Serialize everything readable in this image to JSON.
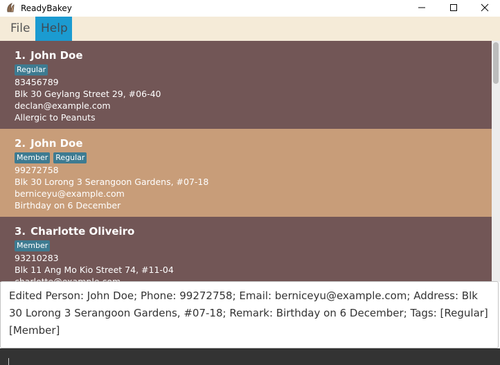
{
  "window": {
    "title": "ReadyBakey",
    "icon": "readybakey-logo-icon"
  },
  "menu": {
    "file": "File",
    "help": "Help"
  },
  "persons": [
    {
      "index": "1.",
      "name": "John Doe",
      "tags": [
        "Regular"
      ],
      "phone": "83456789",
      "address": "Blk 30 Geylang Street 29, #06-40",
      "email": "declan@example.com",
      "remark": "Allergic to Peanuts"
    },
    {
      "index": "2.",
      "name": "John Doe",
      "tags": [
        "Member",
        "Regular"
      ],
      "phone": "99272758",
      "address": "Blk 30 Lorong 3 Serangoon Gardens, #07-18",
      "email": "berniceyu@example.com",
      "remark": "Birthday on 6 December"
    },
    {
      "index": "3.",
      "name": "Charlotte Oliveiro",
      "tags": [
        "Member"
      ],
      "phone": "93210283",
      "address": "Blk 11 Ang Mo Kio Street 74, #11-04",
      "email": "charlotte@example.com",
      "remark": ""
    }
  ],
  "result": {
    "text": "Edited Person: John Doe; Phone: 99272758; Email: berniceyu@example.com; Address: Blk 30 Lorong 3 Serangoon Gardens, #07-18; Remark: Birthday on 6 December; Tags: [Regular][Member]"
  },
  "command": {
    "value": ""
  },
  "colors": {
    "card_odd": "#725656",
    "card_even": "#c89d79",
    "tag": "#3e7b91",
    "menu_bar": "#f5ebd8",
    "menu_active": "#1b9bd1",
    "command_bg": "#333333"
  }
}
